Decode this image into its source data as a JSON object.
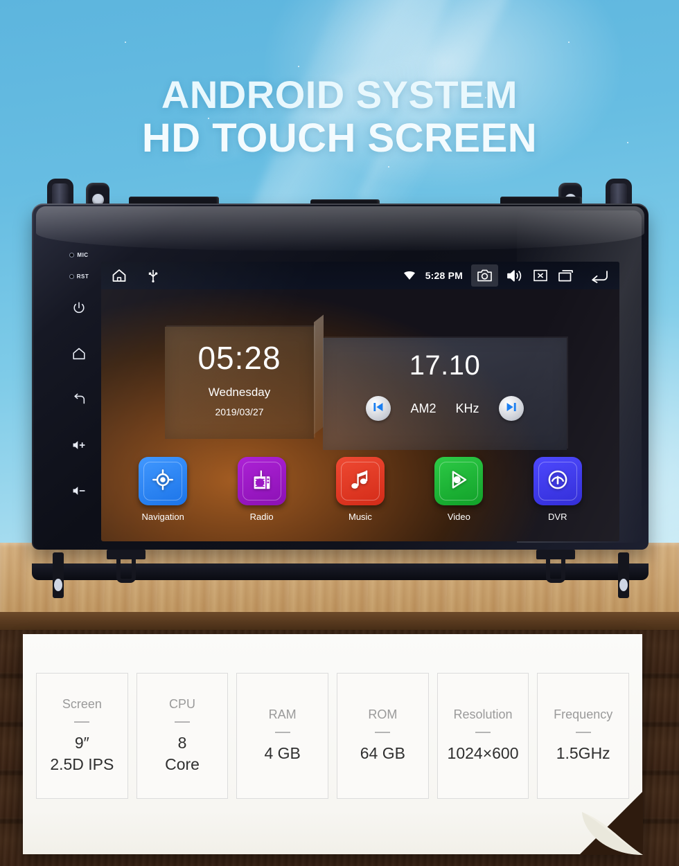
{
  "hero": {
    "line1": "ANDROID SYSTEM",
    "line2": "HD TOUCH SCREEN"
  },
  "device": {
    "side_panel": {
      "mic_label": "MIC",
      "rst_label": "RST",
      "buttons": [
        {
          "name": "power-button",
          "icon": "power-icon"
        },
        {
          "name": "home-button",
          "icon": "home-icon"
        },
        {
          "name": "back-button",
          "icon": "back-arrow-icon"
        },
        {
          "name": "volume-up-button",
          "icon": "volume-up-icon"
        },
        {
          "name": "volume-down-button",
          "icon": "volume-down-icon"
        }
      ]
    },
    "statusbar": {
      "home_icon": "home-icon",
      "usb_icon": "usb-icon",
      "wifi_icon": "wifi-icon",
      "time": "5:28 PM",
      "screenshot_icon": "camera-icon",
      "volume_icon": "volume-icon",
      "close_icon": "close-box-icon",
      "recents_icon": "recents-icon",
      "back_icon": "back-arrow-icon"
    },
    "clock_widget": {
      "time": "05:28",
      "weekday": "Wednesday",
      "date": "2019/03/27"
    },
    "radio_widget": {
      "frequency": "17.10",
      "band": "AM2",
      "unit": "KHz",
      "prev_icon": "skip-previous-icon",
      "next_icon": "skip-next-icon"
    },
    "apps": [
      {
        "label": "Navigation",
        "icon": "navigation-target-icon",
        "color": "#2183f5"
      },
      {
        "label": "Radio",
        "icon": "radio-device-icon",
        "color": "#9c18c4"
      },
      {
        "label": "Music",
        "icon": "music-note-icon",
        "color": "#e03a26"
      },
      {
        "label": "Video",
        "icon": "video-play-icon",
        "color": "#1eb334"
      },
      {
        "label": "DVR",
        "icon": "gauge-icon",
        "color": "#3a36e0"
      }
    ]
  },
  "specs": [
    {
      "key": "Screen",
      "value": "9″\n2.5D IPS"
    },
    {
      "key": "CPU",
      "value": "8\nCore"
    },
    {
      "key": "RAM",
      "value": "4 GB"
    },
    {
      "key": "ROM",
      "value": "64 GB"
    },
    {
      "key": "Resolution",
      "value": "1024×600"
    },
    {
      "key": "Frequency",
      "value": "1.5GHz"
    }
  ],
  "colors": {
    "sky": "#67bde2",
    "headline": "#e9f8fd",
    "wood_light": "#c99f68",
    "wood_dark": "#3a2213",
    "paper": "#fbfbf9"
  }
}
